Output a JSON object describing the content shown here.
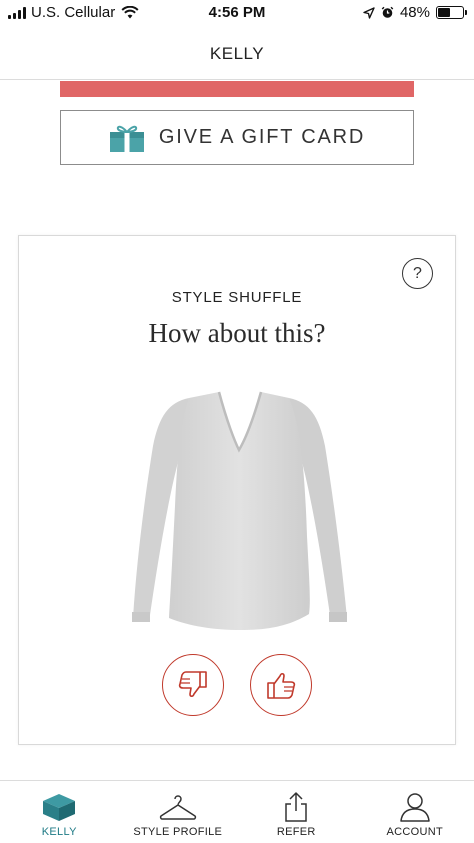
{
  "status_bar": {
    "carrier": "U.S. Cellular",
    "time": "4:56 PM",
    "battery_percent": "48%",
    "battery_level": 0.48
  },
  "header": {
    "title": "KELLY"
  },
  "gift_card": {
    "label": "GIVE A GIFT CARD",
    "icon": "gift-icon",
    "icon_color": "#4ba3a8"
  },
  "style_shuffle": {
    "eyebrow": "STYLE SHUFFLE",
    "title": "How about this?",
    "help_label": "?",
    "product_image": "gray long-sleeve v-neck top",
    "vote_color": "#c0392b"
  },
  "bottom_nav": {
    "items": [
      {
        "label": "KELLY",
        "icon": "box-icon",
        "active": true
      },
      {
        "label": "STYLE PROFILE",
        "icon": "hanger-icon",
        "active": false
      },
      {
        "label": "REFER",
        "icon": "share-icon",
        "active": false
      },
      {
        "label": "ACCOUNT",
        "icon": "person-icon",
        "active": false
      }
    ]
  },
  "colors": {
    "accent_red": "#e06666",
    "teal": "#2a8a94"
  }
}
